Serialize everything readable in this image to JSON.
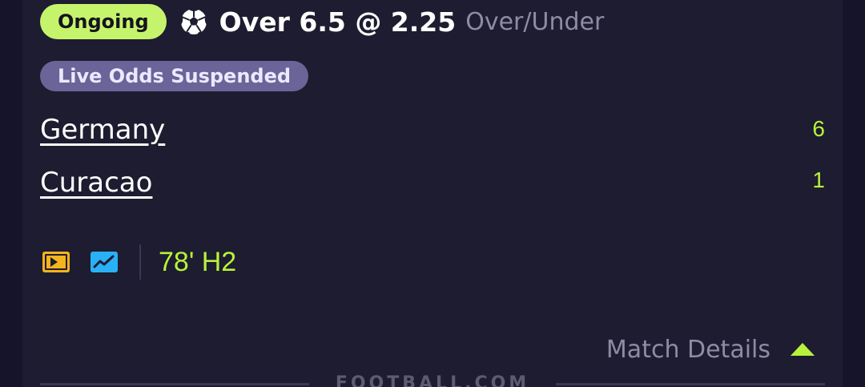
{
  "bet": {
    "status": "Ongoing",
    "selection": "Over 6.5 @ 2.25",
    "market": "Over/Under",
    "sport_icon": "soccer-ball-icon",
    "odds_status": "Live Odds Suspended"
  },
  "match": {
    "home": {
      "name": "Germany",
      "score": "6"
    },
    "away": {
      "name": "Curacao",
      "score": "1"
    },
    "clock": "78' H2"
  },
  "actions": {
    "stream_icon": "live-stream-icon",
    "stats_icon": "stats-chart-icon",
    "details_label": "Match Details",
    "details_icon": "chevron-up-icon"
  },
  "footer": {
    "watermark": "FOOTBALL.COM"
  },
  "colors": {
    "status_badge": "#c6f36c",
    "accent_green": "#b8f23a",
    "odds_badge": "#6a6498",
    "stream_icon": "#f5b41c",
    "stats_icon": "#2ab0f5",
    "card_bg": "#1e1c30"
  }
}
